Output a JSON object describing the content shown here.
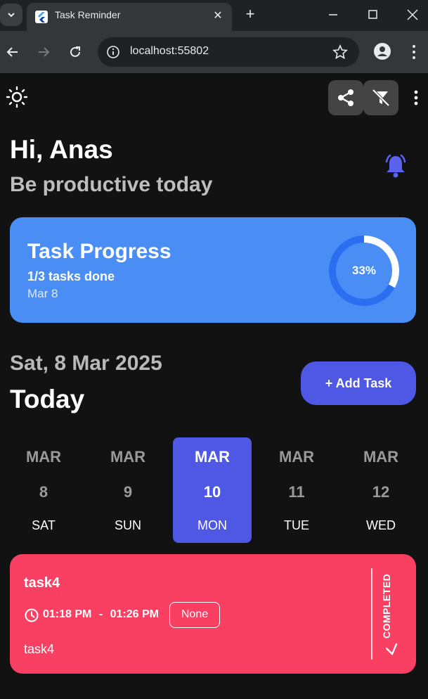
{
  "browser": {
    "tab_title": "Task Reminder",
    "tab_close": "✕",
    "new_tab": "+",
    "url": "localhost:55802"
  },
  "app": {
    "greeting": "Hi, Anas",
    "subtitle": "Be productive today",
    "progress": {
      "title": "Task Progress",
      "count_text": "1/3 tasks done",
      "date": "Mar 8",
      "percent_label": "33%",
      "percent": 33
    },
    "date_line": "Sat, 8 Mar 2025",
    "today_label": "Today",
    "add_task_label": "+ Add Task",
    "days": [
      {
        "month": "MAR",
        "date": "8",
        "weekday": "SAT"
      },
      {
        "month": "MAR",
        "date": "9",
        "weekday": "SUN"
      },
      {
        "month": "MAR",
        "date": "10",
        "weekday": "MON"
      },
      {
        "month": "MAR",
        "date": "11",
        "weekday": "TUE"
      },
      {
        "month": "MAR",
        "date": "12",
        "weekday": "WED"
      }
    ],
    "task": {
      "title": "task4",
      "start_time": "01:18 PM",
      "separator": "-",
      "end_time": "01:26 PM",
      "repeat": "None",
      "note": "task4",
      "status": "COMPLETED",
      "color": "#fa4062"
    }
  }
}
